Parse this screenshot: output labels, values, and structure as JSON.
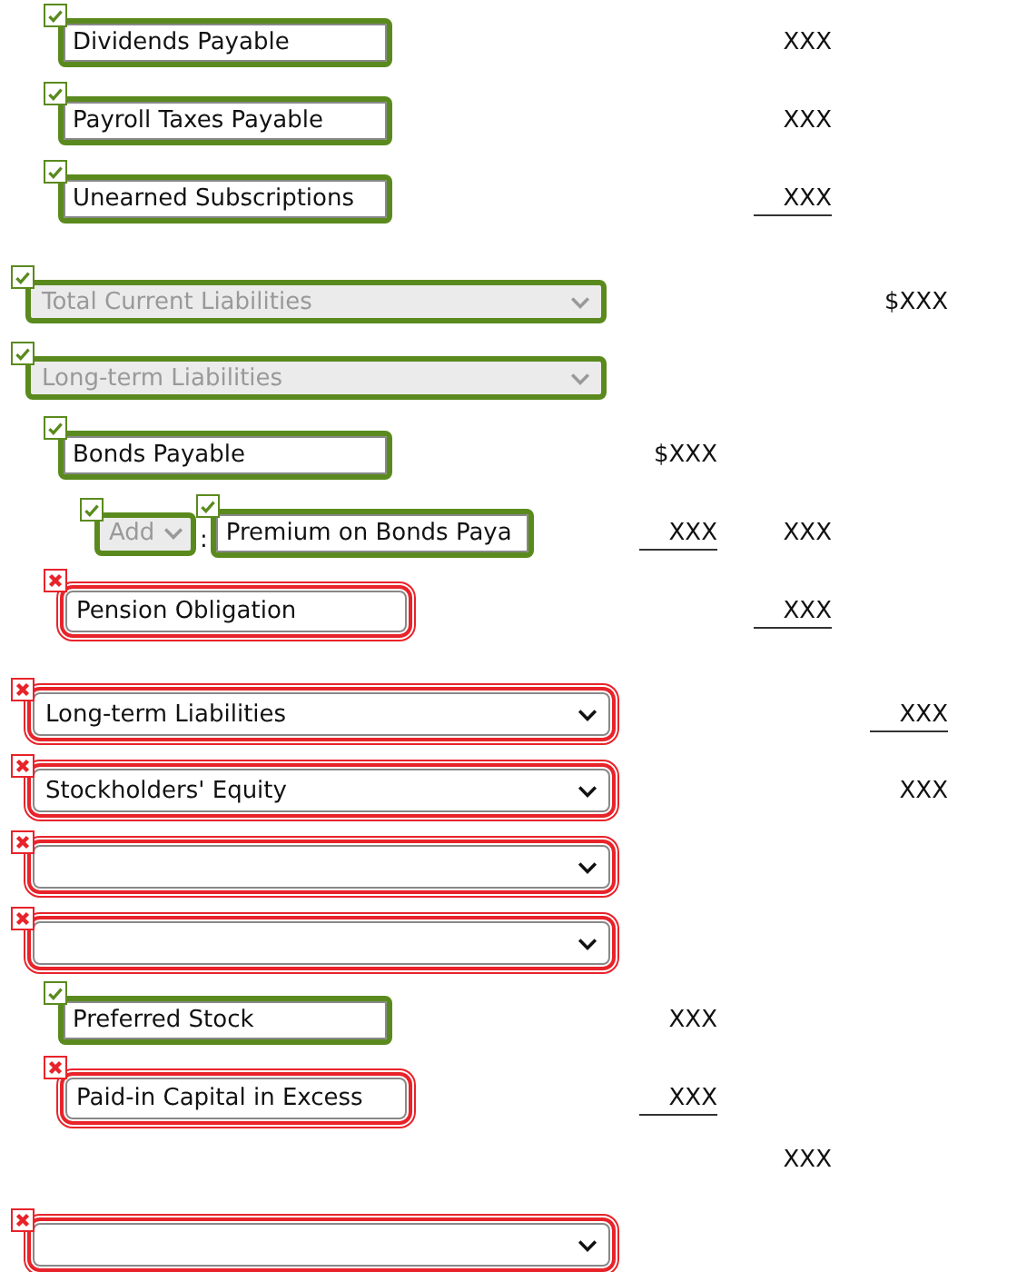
{
  "rows": [
    {
      "field": {
        "kind": "text",
        "value": "Dividends Payable",
        "correct": true
      },
      "column_2": {
        "text": "XXX",
        "underlined": false
      }
    },
    {
      "field": {
        "kind": "text",
        "value": "Payroll Taxes Payable",
        "correct": true
      },
      "column_2": {
        "text": "XXX",
        "underlined": false
      }
    },
    {
      "field": {
        "kind": "text",
        "value": "Unearned Subscriptions",
        "correct": true
      },
      "column_2": {
        "text": "XXX",
        "underlined": true
      }
    },
    {
      "field": {
        "kind": "select",
        "value": "Total Current Liabilities",
        "correct": true,
        "disabled": true
      },
      "column_3": {
        "text": "$XXX",
        "underlined": false
      }
    },
    {
      "field": {
        "kind": "select",
        "value": "Long-term Liabilities",
        "correct": true,
        "disabled": true
      }
    },
    {
      "field": {
        "kind": "text",
        "value": "Bonds Payable",
        "correct": true
      },
      "column_1": {
        "text": "$XXX",
        "underlined": false
      }
    },
    {
      "field": {
        "kind": "adjustment",
        "operator": {
          "value": "Add",
          "correct": true,
          "disabled": true
        },
        "separator": ":",
        "value": "Premium on Bonds Paya",
        "correct": true
      },
      "column_1": {
        "text": "XXX",
        "underlined": true
      },
      "column_2": {
        "text": "XXX",
        "underlined": false
      }
    },
    {
      "field": {
        "kind": "text",
        "value": "Pension Obligation",
        "correct": false
      },
      "column_2": {
        "text": "XXX",
        "underlined": true
      }
    },
    {
      "field": {
        "kind": "select",
        "value": "Long-term Liabilities",
        "correct": false,
        "disabled": false
      },
      "column_3": {
        "text": "XXX",
        "underlined": true
      }
    },
    {
      "field": {
        "kind": "select",
        "value": "Stockholders' Equity",
        "correct": false,
        "disabled": false
      },
      "column_3": {
        "text": "XXX",
        "underlined": false
      }
    },
    {
      "field": {
        "kind": "select",
        "correct": false,
        "disabled": false
      }
    },
    {
      "field": {
        "kind": "select",
        "correct": false,
        "disabled": false
      }
    },
    {
      "field": {
        "kind": "text",
        "value": "Preferred Stock",
        "correct": true
      },
      "column_1": {
        "text": "XXX",
        "underlined": false
      }
    },
    {
      "field": {
        "kind": "text",
        "value": "Paid-in Capital in Excess",
        "correct": false
      },
      "column_1": {
        "text": "XXX",
        "underlined": true
      }
    },
    {
      "field": {
        "kind": "none"
      },
      "column_2": {
        "text": "XXX",
        "underlined": false
      }
    },
    {
      "field": {
        "kind": "select",
        "correct": false,
        "disabled": false
      }
    }
  ]
}
